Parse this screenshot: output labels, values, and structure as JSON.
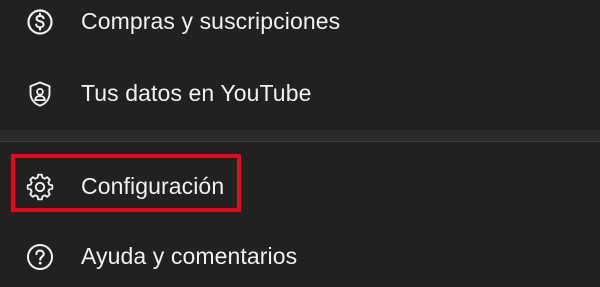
{
  "menu": {
    "items": [
      {
        "label": "Compras y suscripciones",
        "icon": "dollar-circle-icon"
      },
      {
        "label": "Tus datos en YouTube",
        "icon": "shield-person-icon"
      },
      {
        "label": "Configuración",
        "icon": "gear-icon"
      },
      {
        "label": "Ayuda y comentarios",
        "icon": "help-circle-icon"
      }
    ]
  },
  "colors": {
    "background": "#212121",
    "text": "#f1f1f1",
    "highlight": "#e8071a",
    "divider": "#3d3d3d"
  }
}
